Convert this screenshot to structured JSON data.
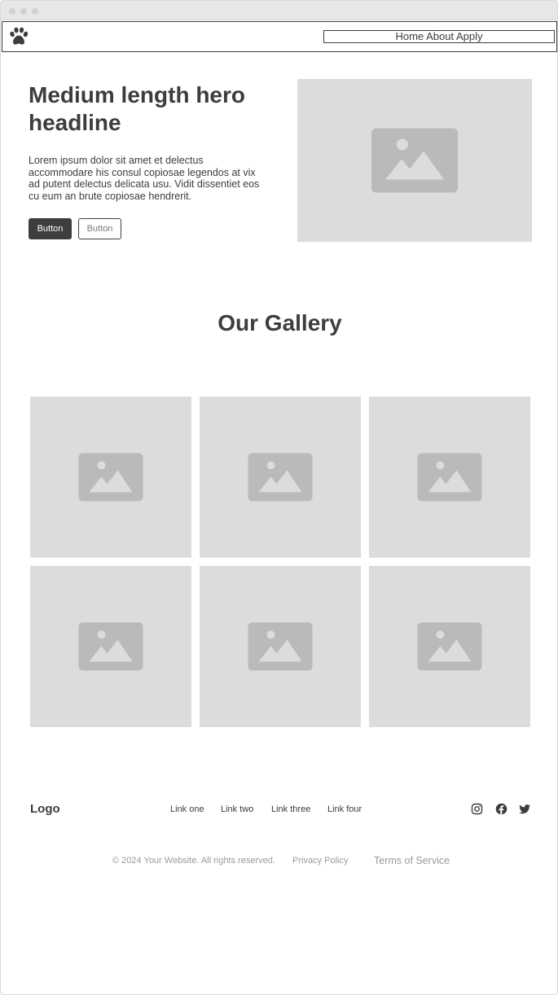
{
  "nav": {
    "logo_icon": "paw-icon",
    "links": [
      "Home",
      "About",
      "Apply"
    ]
  },
  "hero": {
    "title": "Medium length hero headline",
    "text": "Lorem ipsum dolor sit amet et delectus accommodare his consul copiosae legendos at vix ad putent delectus delicata usu. Vidit dissentiet eos cu eum an brute copiosae hendrerit.",
    "primary_button": "Button",
    "secondary_button": "Button",
    "image_icon": "image-placeholder-icon"
  },
  "gallery": {
    "title": "Our Gallery",
    "image_count": 6
  },
  "footer": {
    "logo": "Logo",
    "links": [
      "Link one",
      "Link two",
      "Link three",
      "Link four"
    ],
    "social_icons": [
      "instagram-icon",
      "facebook-icon",
      "twitter-icon"
    ],
    "copyright": "© 2024 Your Website. All rights reserved.",
    "privacy": "Privacy Policy",
    "terms": "Terms of Service"
  },
  "colors": {
    "text": "#3d3d3d",
    "placeholder_bg": "#dcdcdc",
    "placeholder_icon": "#bababa",
    "muted": "#9a9a9a"
  }
}
